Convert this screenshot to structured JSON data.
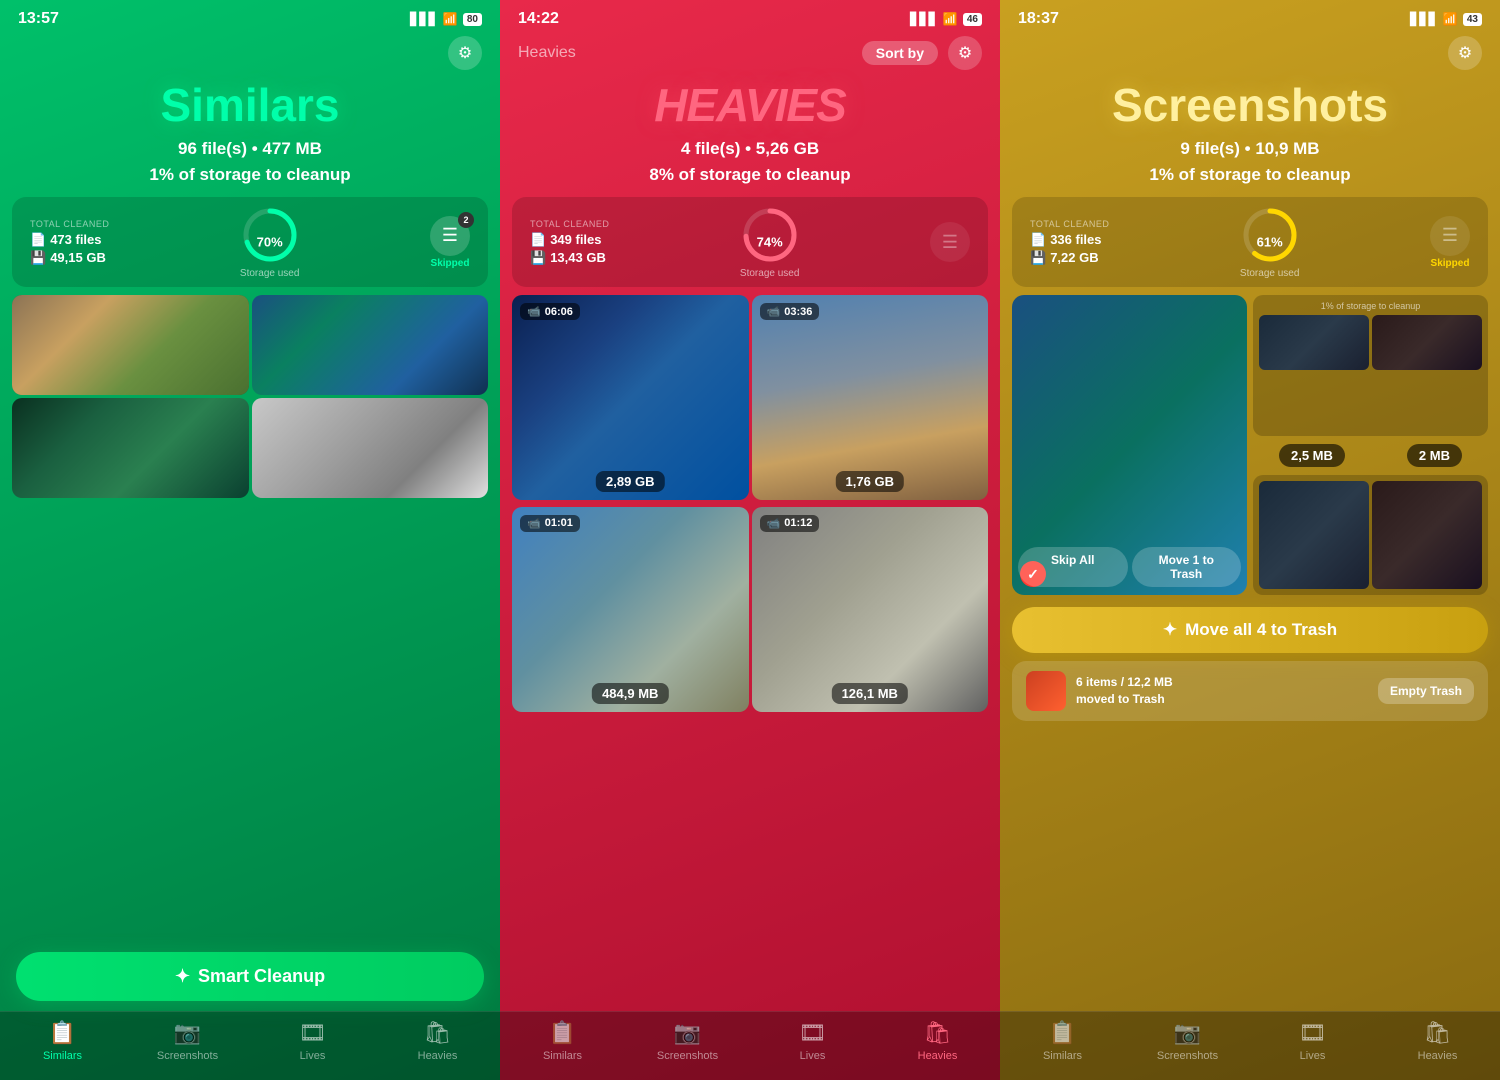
{
  "panels": [
    {
      "id": "similars",
      "bg": "green",
      "status": {
        "time": "13:57",
        "signal": "▋▋▋",
        "wifi": "wifi",
        "battery": "80"
      },
      "nav": {
        "title": "",
        "showSort": false,
        "gear": "⚙"
      },
      "hero": {
        "title": "Similars",
        "subtitle1": "96 file(s) • 477 MB",
        "subtitle2": "1% of storage to cleanup"
      },
      "stats": {
        "label": "TOTAL CLEANED",
        "files": "473 files",
        "size": "49,15 GB",
        "percent": 70,
        "skippedBadge": "2",
        "storageLabel": "Storage used",
        "skippedLabel": "Skipped"
      },
      "button": {
        "label": "Smart Cleanup",
        "star": "✦"
      },
      "tabs": [
        {
          "icon": "📋",
          "label": "Similars",
          "active": true
        },
        {
          "icon": "📷",
          "label": "Screenshots",
          "active": false
        },
        {
          "icon": "🎞",
          "label": "Lives",
          "active": false
        },
        {
          "icon": "🛍",
          "label": "Heavies",
          "active": false
        }
      ]
    },
    {
      "id": "heavies",
      "bg": "red",
      "status": {
        "time": "14:22",
        "signal": "▋▋▋",
        "wifi": "wifi",
        "battery": "46"
      },
      "nav": {
        "title": "Heavies",
        "showSort": true,
        "sortLabel": "Sort by",
        "gear": "⚙"
      },
      "hero": {
        "title": "HEAVIES",
        "subtitle1": "4 file(s) • 5,26 GB",
        "subtitle2": "8% of storage to cleanup"
      },
      "stats": {
        "label": "TOTAL CLEANED",
        "files": "349 files",
        "size": "13,43 GB",
        "percent": 74,
        "storageLabel": "Storage used"
      },
      "videos": [
        {
          "duration": "06:06",
          "size": "2,89 GB",
          "type": "underwater"
        },
        {
          "duration": "03:36",
          "size": "1,76 GB",
          "type": "cathedral"
        },
        {
          "duration": "01:01",
          "size": "484,9 MB",
          "type": "harbor"
        },
        {
          "duration": "01:12",
          "size": "126,1 MB",
          "type": "fog"
        }
      ],
      "tabs": [
        {
          "icon": "📋",
          "label": "Similars",
          "active": false
        },
        {
          "icon": "📷",
          "label": "Screenshots",
          "active": false
        },
        {
          "icon": "🎞",
          "label": "Lives",
          "active": false
        },
        {
          "icon": "🛍",
          "label": "Heavies",
          "active": true
        }
      ]
    },
    {
      "id": "screenshots",
      "bg": "yellow",
      "status": {
        "time": "18:37",
        "signal": "▋▋▋",
        "wifi": "wifi",
        "battery": "43"
      },
      "nav": {
        "title": "",
        "showSort": false,
        "gear": "⚙"
      },
      "hero": {
        "title": "Screenshots",
        "subtitle1": "9 file(s) • 10,9 MB",
        "subtitle2": "1% of storage to cleanup"
      },
      "stats": {
        "label": "TOTAL CLEANED",
        "files": "336 files",
        "size": "7,22 GB",
        "percent": 61,
        "storageLabel": "Storage used",
        "skippedLabel": "Skipped"
      },
      "sizes": [
        "2,5 MB",
        "2 MB"
      ],
      "moveAllBtn": "Move all 4 to Trash",
      "star": "✦",
      "trash": {
        "text1": "6 items / 12,2 MB",
        "text2": "moved to Trash",
        "emptyBtn": "Empty Trash"
      },
      "tabs": [
        {
          "icon": "📋",
          "label": "Similars",
          "active": false
        },
        {
          "icon": "📷",
          "label": "Screenshots",
          "active": false
        },
        {
          "icon": "🎞",
          "label": "Lives",
          "active": false
        },
        {
          "icon": "🛍",
          "label": "Heavies",
          "active": false
        }
      ]
    }
  ]
}
